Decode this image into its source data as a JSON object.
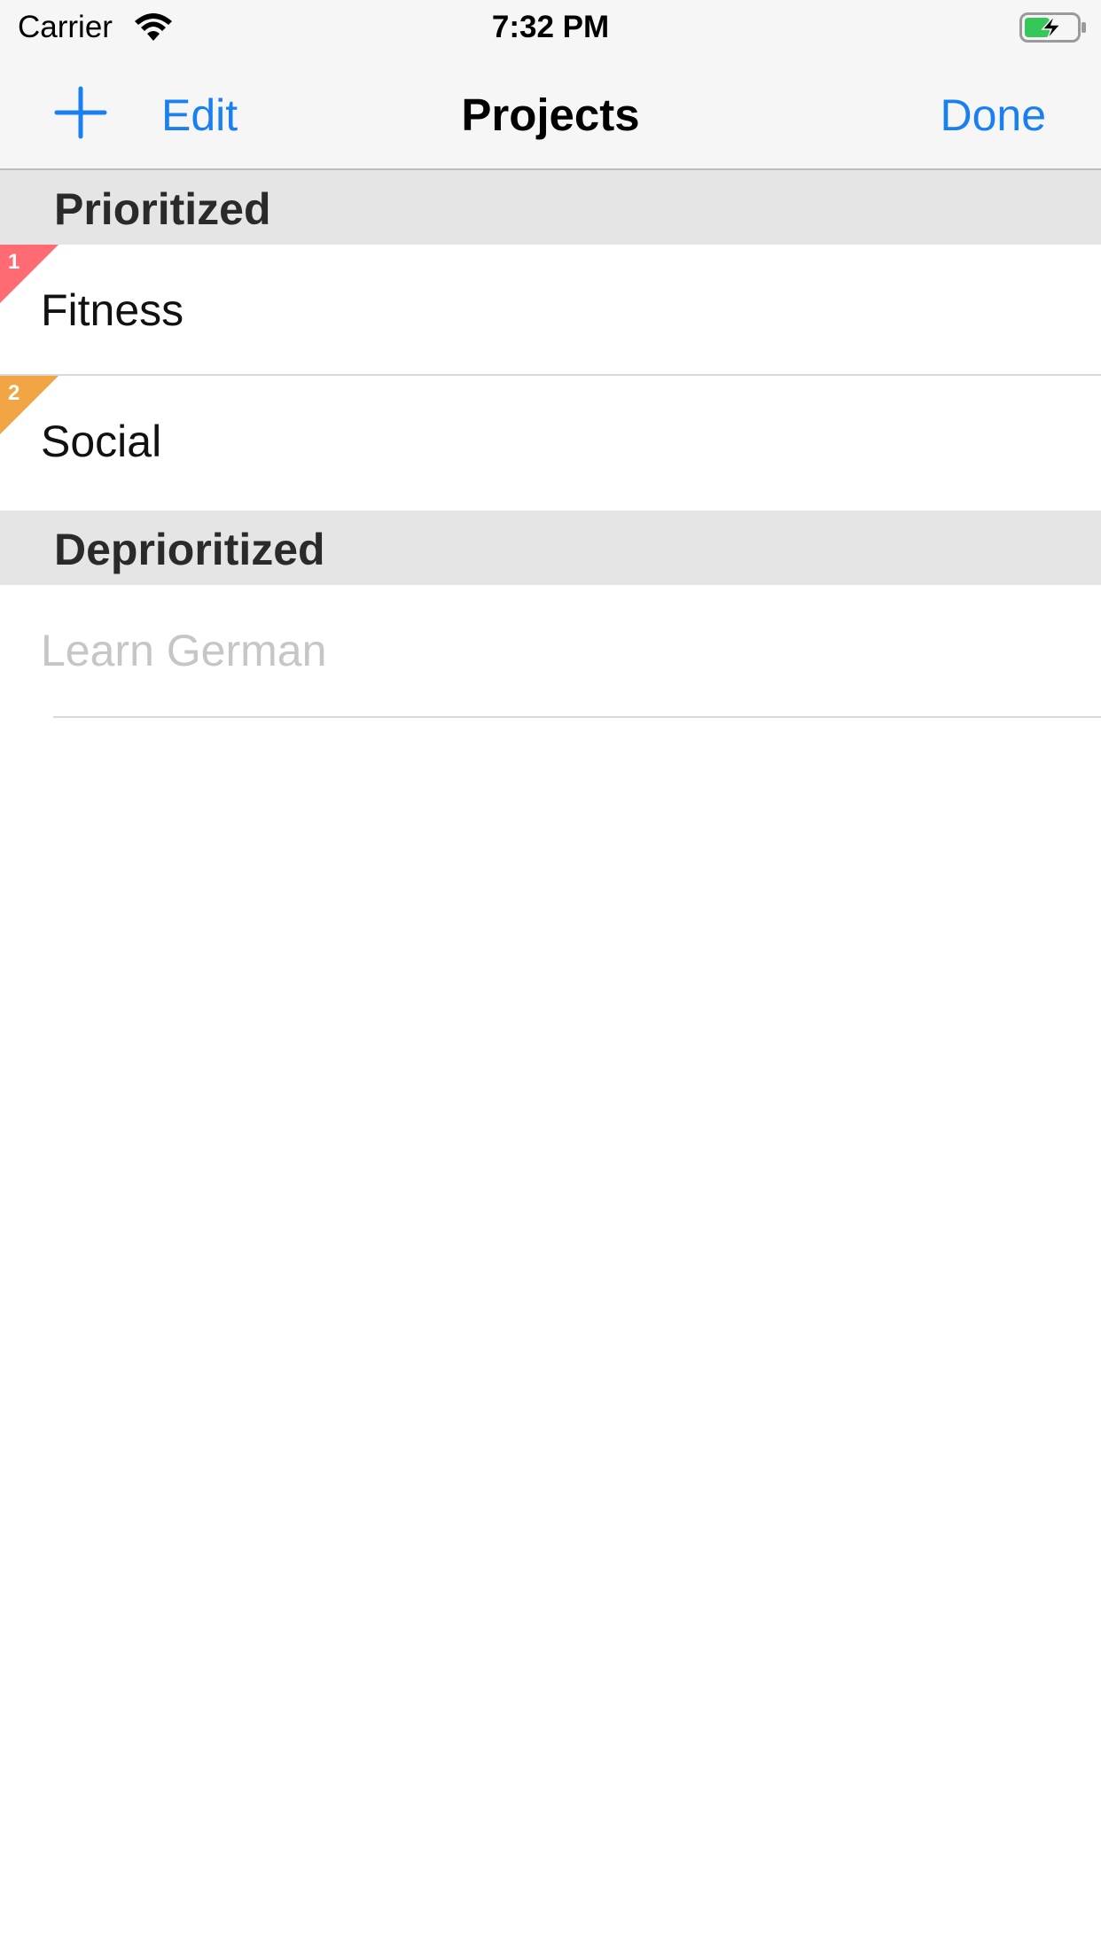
{
  "status_bar": {
    "carrier": "Carrier",
    "time": "7:32 PM",
    "wifi_icon": "wifi-icon",
    "battery_icon": "battery-charging-icon"
  },
  "nav": {
    "add_icon": "plus-icon",
    "edit_label": "Edit",
    "title": "Projects",
    "done_label": "Done"
  },
  "sections": [
    {
      "title": "Prioritized",
      "rows": [
        {
          "label": "Fitness",
          "priority": "1",
          "priority_color": "#ff6b73"
        },
        {
          "label": "Social",
          "priority": "2",
          "priority_color": "#f2a544"
        }
      ]
    },
    {
      "title": "Deprioritized",
      "rows": [
        {
          "label": "Learn German"
        }
      ]
    }
  ],
  "colors": {
    "accent": "#1a7ff0",
    "section_bg": "#e5e5e6",
    "nav_bg": "#f6f6f7",
    "dimmed_text": "#c6c6c8"
  }
}
